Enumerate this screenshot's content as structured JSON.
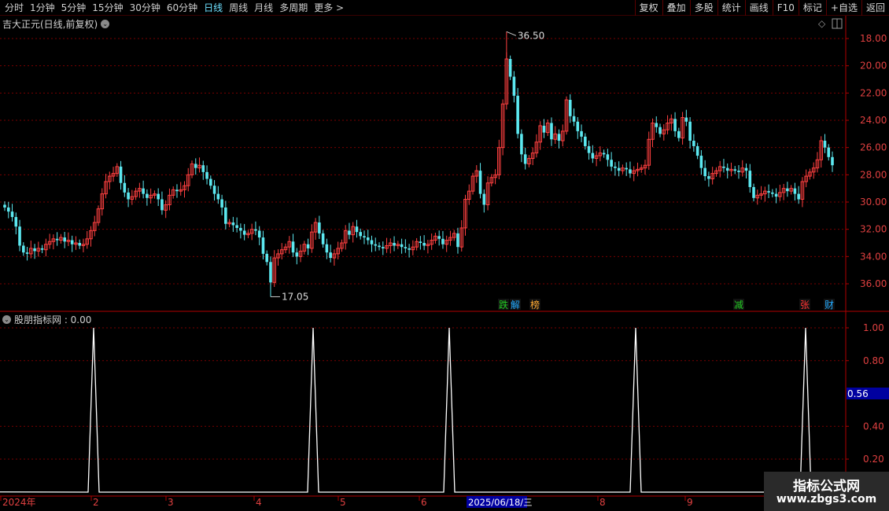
{
  "toolbar": {
    "periods": [
      "分时",
      "1分钟",
      "5分钟",
      "15分钟",
      "30分钟",
      "60分钟",
      "日线",
      "周线",
      "月线",
      "多周期",
      "更多 >"
    ],
    "active_period": "日线",
    "right_buttons": [
      "复权",
      "叠加",
      "多股",
      "统计",
      "画线",
      "F10",
      "标记",
      "+自选",
      "返回"
    ]
  },
  "main_pane": {
    "title": "吉大正元(日线,前复权)",
    "high_label": "36.50",
    "low_label": "17.05",
    "event_tags": [
      {
        "text": "跌",
        "color": "#22cc22"
      },
      {
        "text": "解",
        "color": "#22aaff"
      },
      {
        "text": "榜",
        "color": "#ffaa33"
      },
      {
        "text": "减",
        "color": "#22cc22"
      },
      {
        "text": "张",
        "color": "#ff3333"
      },
      {
        "text": "财",
        "color": "#22aaff"
      }
    ],
    "y_ticks": [
      "36.00",
      "34.00",
      "32.00",
      "30.00",
      "28.00",
      "26.00",
      "24.00",
      "22.00",
      "20.00",
      "18.00"
    ]
  },
  "indicator_pane": {
    "title": "股朋指标网 : 0.00",
    "y_ticks": [
      "1.00",
      "0.80",
      "0.40",
      "0.20"
    ],
    "current_value": "0.56"
  },
  "x_axis": {
    "labels": [
      "2024年",
      "2",
      "3",
      "4",
      "5",
      "6",
      "8",
      "9"
    ],
    "cursor_date": "2025/06/18/三"
  },
  "watermark": {
    "title": "指标公式网",
    "url": "www.zbgs3.com"
  },
  "colors": {
    "up": "#ff4040",
    "down": "#5ce8f0",
    "grid": "#7a0000",
    "axis": "#b00000"
  },
  "chart_data": [
    {
      "type": "candlestick",
      "title": "吉大正元(日线,前复权)",
      "ylim": [
        17,
        37
      ],
      "y_ticks": [
        18,
        20,
        22,
        24,
        26,
        28,
        30,
        32,
        34,
        36
      ],
      "high": 36.5,
      "low": 17.05,
      "series": [
        {
          "name": "close",
          "values": [
            23.6,
            23.3,
            22.9,
            22.2,
            20.8,
            20.3,
            20.2,
            20.6,
            20.4,
            20.6,
            20.5,
            20.9,
            21.1,
            21.3,
            21.2,
            21.4,
            21.1,
            21.2,
            20.9,
            21.0,
            20.8,
            20.9,
            21.3,
            21.9,
            22.5,
            23.5,
            24.6,
            25.5,
            25.9,
            26.1,
            26.6,
            25.4,
            24.7,
            24.2,
            24.4,
            24.8,
            25.0,
            24.6,
            24.3,
            24.5,
            24.6,
            24.2,
            23.4,
            23.8,
            24.5,
            24.9,
            24.8,
            24.9,
            25.2,
            26.0,
            26.8,
            26.5,
            26.7,
            26.2,
            25.7,
            25.2,
            24.6,
            24.2,
            23.6,
            22.4,
            22.5,
            22.3,
            22.1,
            21.9,
            21.6,
            21.7,
            22.0,
            21.9,
            21.4,
            20.2,
            19.6,
            18.1,
            19.9,
            20.2,
            20.5,
            20.7,
            21.1,
            20.3,
            20.0,
            20.4,
            20.9,
            20.6,
            21.8,
            22.5,
            21.7,
            20.9,
            20.3,
            19.9,
            20.2,
            20.6,
            21.0,
            21.9,
            21.6,
            22.2,
            21.8,
            21.5,
            21.4,
            21.2,
            20.9,
            20.8,
            20.7,
            20.6,
            20.8,
            21.0,
            20.8,
            20.9,
            20.7,
            20.6,
            20.5,
            20.7,
            21.1,
            21.0,
            20.8,
            20.9,
            21.2,
            21.5,
            21.3,
            20.9,
            21.2,
            21.4,
            21.7,
            20.7,
            22.1,
            24.2,
            24.8,
            25.9,
            26.3,
            24.6,
            23.8,
            25.4,
            25.8,
            26.0,
            28.0,
            31.2,
            34.5,
            33.2,
            31.8,
            29.0,
            27.5,
            26.8,
            27.2,
            27.6,
            28.4,
            29.6,
            29.1,
            29.8,
            28.6,
            29.0,
            28.5,
            29.2,
            31.5,
            30.3,
            29.9,
            29.2,
            28.8,
            28.1,
            27.6,
            27.2,
            27.4,
            27.6,
            27.5,
            27.1,
            26.6,
            26.5,
            26.3,
            26.5,
            26.4,
            26.1,
            26.3,
            26.4,
            26.5,
            26.7,
            28.6,
            29.8,
            29.5,
            29.0,
            29.3,
            29.8,
            30.1,
            29.2,
            28.7,
            30.2,
            29.9,
            28.5,
            28.1,
            27.4,
            26.5,
            25.9,
            25.7,
            26.1,
            26.3,
            26.6,
            26.5,
            26.3,
            26.4,
            26.3,
            26.2,
            26.5,
            26.3,
            25.1,
            24.3,
            24.5,
            24.6,
            24.8,
            24.7,
            24.6,
            24.4,
            24.7,
            25.0,
            24.8,
            25.0,
            24.6,
            24.2,
            25.5,
            25.9,
            26.2,
            26.5,
            27.1,
            28.5,
            28.0,
            27.3,
            26.7
          ]
        }
      ]
    },
    {
      "type": "line",
      "title": "股朋指标网",
      "ylim": [
        0,
        1.05
      ],
      "y_ticks": [
        1.0,
        0.8,
        0.4,
        0.2
      ],
      "x_peaks": [
        "2024-02",
        "2024-04",
        "2024-06",
        "2024-08",
        "2024-10"
      ],
      "series": [
        {
          "name": "股朋指标网",
          "values": [
            0,
            1,
            0,
            1,
            0,
            1,
            0,
            1,
            0,
            1,
            0
          ]
        }
      ],
      "current": 0.0
    }
  ]
}
